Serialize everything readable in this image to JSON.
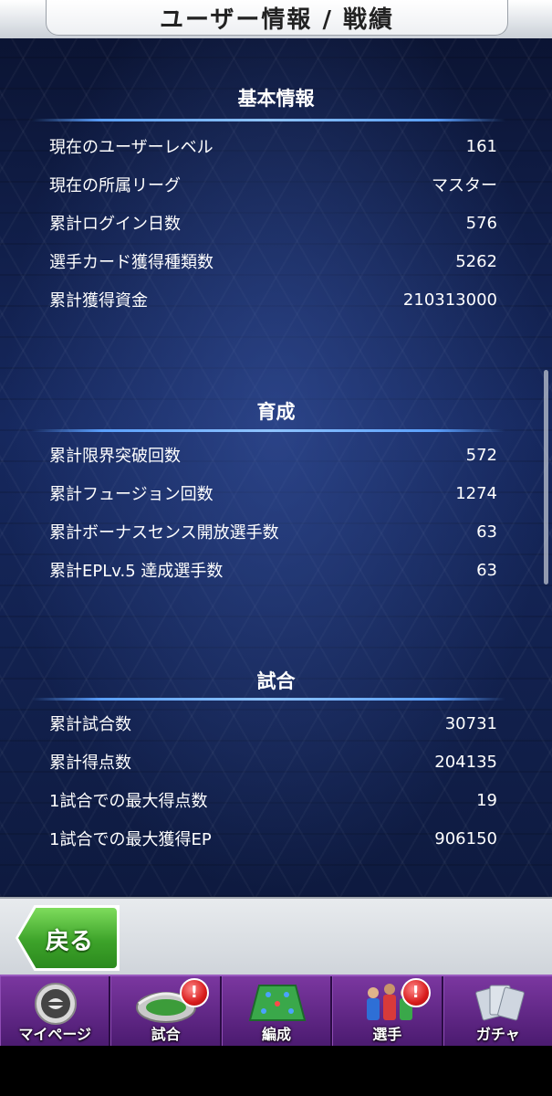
{
  "header": {
    "title": "ユーザー情報 / 戦績"
  },
  "sections": [
    {
      "title": "基本情報",
      "rows": [
        {
          "label": "現在のユーザーレベル",
          "value": "161"
        },
        {
          "label": "現在の所属リーグ",
          "value": "マスター"
        },
        {
          "label": "累計ログイン日数",
          "value": "576"
        },
        {
          "label": "選手カード獲得種類数",
          "value": "5262"
        },
        {
          "label": "累計獲得資金",
          "value": "210313000"
        }
      ]
    },
    {
      "title": "育成",
      "rows": [
        {
          "label": "累計限界突破回数",
          "value": "572"
        },
        {
          "label": "累計フュージョン回数",
          "value": "1274"
        },
        {
          "label": "累計ボーナスセンス開放選手数",
          "value": "63"
        },
        {
          "label": "累計EPLv.5 達成選手数",
          "value": "63"
        }
      ]
    },
    {
      "title": "試合",
      "rows": [
        {
          "label": "累計試合数",
          "value": "30731"
        },
        {
          "label": "累計得点数",
          "value": "204135"
        },
        {
          "label": "1試合での最大得点数",
          "value": "19"
        },
        {
          "label": "1試合での最大獲得EP",
          "value": "906150"
        }
      ]
    }
  ],
  "back_button": {
    "label": "戻る"
  },
  "nav": [
    {
      "label": "マイページ",
      "icon": "efootball-logo-icon",
      "badge": ""
    },
    {
      "label": "試合",
      "icon": "stadium-icon",
      "badge": "!"
    },
    {
      "label": "編成",
      "icon": "formation-pitch-icon",
      "badge": ""
    },
    {
      "label": "選手",
      "icon": "players-icon",
      "badge": "!"
    },
    {
      "label": "ガチャ",
      "icon": "cards-icon",
      "badge": ""
    }
  ]
}
